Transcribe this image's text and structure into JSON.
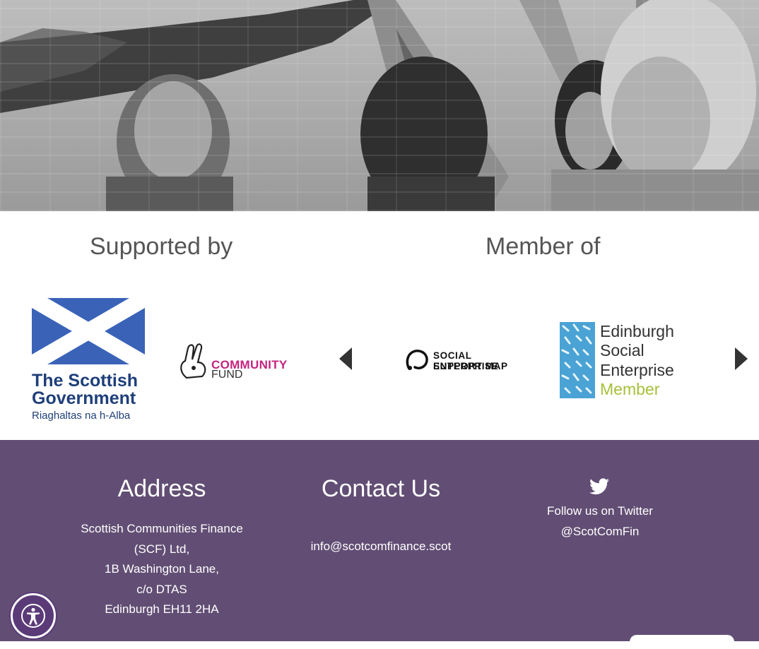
{
  "sections": {
    "supported_title": "Supported by",
    "member_title": "Member of"
  },
  "logos": {
    "scottish_gov": {
      "line1": "The Scottish",
      "line2": "Government",
      "line3": "Riaghaltas na h-Alba"
    },
    "community_fund": {
      "line1": "COMMUNITY",
      "line2": "FUND"
    },
    "se_map": {
      "line1": "SOCIAL ENTERPRISE",
      "line2": "SUPPORT MAP"
    },
    "edinburgh": {
      "line1": "Edinburgh",
      "line2": "Social",
      "line3": "Enterprise",
      "line4": "Member"
    }
  },
  "footer": {
    "address_title": "Address",
    "address_lines": [
      "Scottish Communities Finance",
      "(SCF) Ltd,",
      "1B Washington Lane,",
      "c/o DTAS",
      "Edinburgh EH11 2HA"
    ],
    "contact_title": "Contact Us",
    "email": "info@scotcomfinance.scot",
    "twitter_label": "Follow us on Twitter",
    "twitter_handle": "@ScotComFin"
  },
  "colors": {
    "footer_bg": "#624e74",
    "saltire_blue": "#3a63b8",
    "community_pink": "#c4247f",
    "edinburgh_green": "#a7c03a"
  },
  "icons": [
    "twitter-icon",
    "accessibility-icon",
    "arrow-left-icon",
    "arrow-right-icon"
  ]
}
